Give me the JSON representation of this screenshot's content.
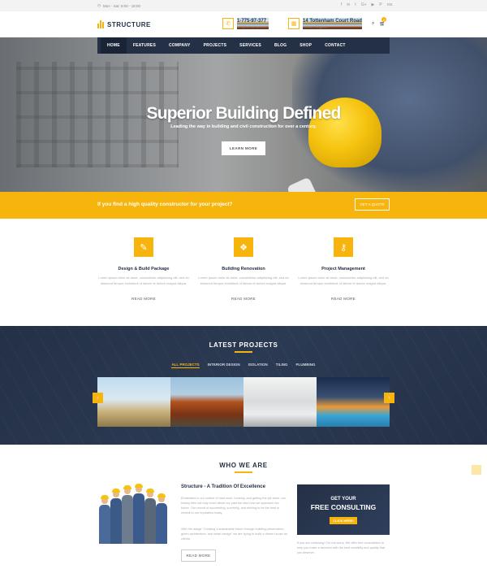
{
  "topbar": {
    "hours": "Mon - Sat: 9:00 - 18:00",
    "social": [
      "f",
      "in",
      "t",
      "G+",
      "▶",
      "P",
      "rss"
    ]
  },
  "header": {
    "logo": "STRUCTURE",
    "phone": "1-775-97-377",
    "email": "info@hemeinsce.com",
    "address": "14 Tottenham Court Road",
    "city": "London, England",
    "cart_count": "0"
  },
  "nav": [
    "HOME",
    "FEATURES",
    "COMPANY",
    "PROJECTS",
    "SERVICES",
    "BLOG",
    "SHOP",
    "CONTACT"
  ],
  "hero": {
    "title": "Superior Building Defined",
    "subtitle": "Leading the way in building and civil construction for over a century.",
    "button": "LEARN MORE"
  },
  "quote": {
    "text": "If you find a high quality constructor for your project?",
    "button": "GET A QUOTE"
  },
  "services": [
    {
      "icon": "brush-icon",
      "title": "Design & Build Package",
      "text": "Lorem ipsum dolor sit amet, consectetur adipisicing elit, sed do eiusmod tempor incididunt ut labore et dolore magna aliqua.",
      "more": "READ MORE"
    },
    {
      "icon": "blocks-icon",
      "title": "Building Renovation",
      "text": "Lorem ipsum dolor sit amet, consectetur adipisicing elit, sed do eiusmod tempor incididunt ut labore et dolore magna aliqua.",
      "more": "READ MORE"
    },
    {
      "icon": "key-icon",
      "title": "Project Management",
      "text": "Lorem ipsum dolor sit amet, consectetur adipisicing elit, sed do eiusmod tempor incididunt ut labore et dolore magna aliqua.",
      "more": "READ MORE"
    }
  ],
  "projects": {
    "title": "LATEST PROJECTS",
    "filters": [
      "ALL PROJECTS",
      "INTERIOR DESIGN",
      "ISOLATION",
      "TILING",
      "PLUMBING"
    ]
  },
  "who": {
    "title": "WHO WE ARE",
    "subtitle": "Structure - A Tradition Of Excellence",
    "p1": "Embedded in our culture of hard work, honesty, and getting the job done, our history tells not only much about our past but also how we approach our future. Our record of succeeding, surviving, and striving to be the best is central to our reputation today.",
    "p2": "With the adage \"Creating a sustainable future through building preservation, green architecture, and smart design\" we are trying to build a dream house for clients.",
    "button": "READ MORE",
    "promo_a": "GET YOUR",
    "promo_b": "FREE CONSULTING",
    "promo_c": "CLICK HERE!",
    "promo_text": "If you are confusing? Do not worry. We offer free consultation to help you make a decision with the best creativity and quality that you deserve."
  },
  "colors": {
    "accent": "#f6b40c",
    "navy": "#243045"
  }
}
